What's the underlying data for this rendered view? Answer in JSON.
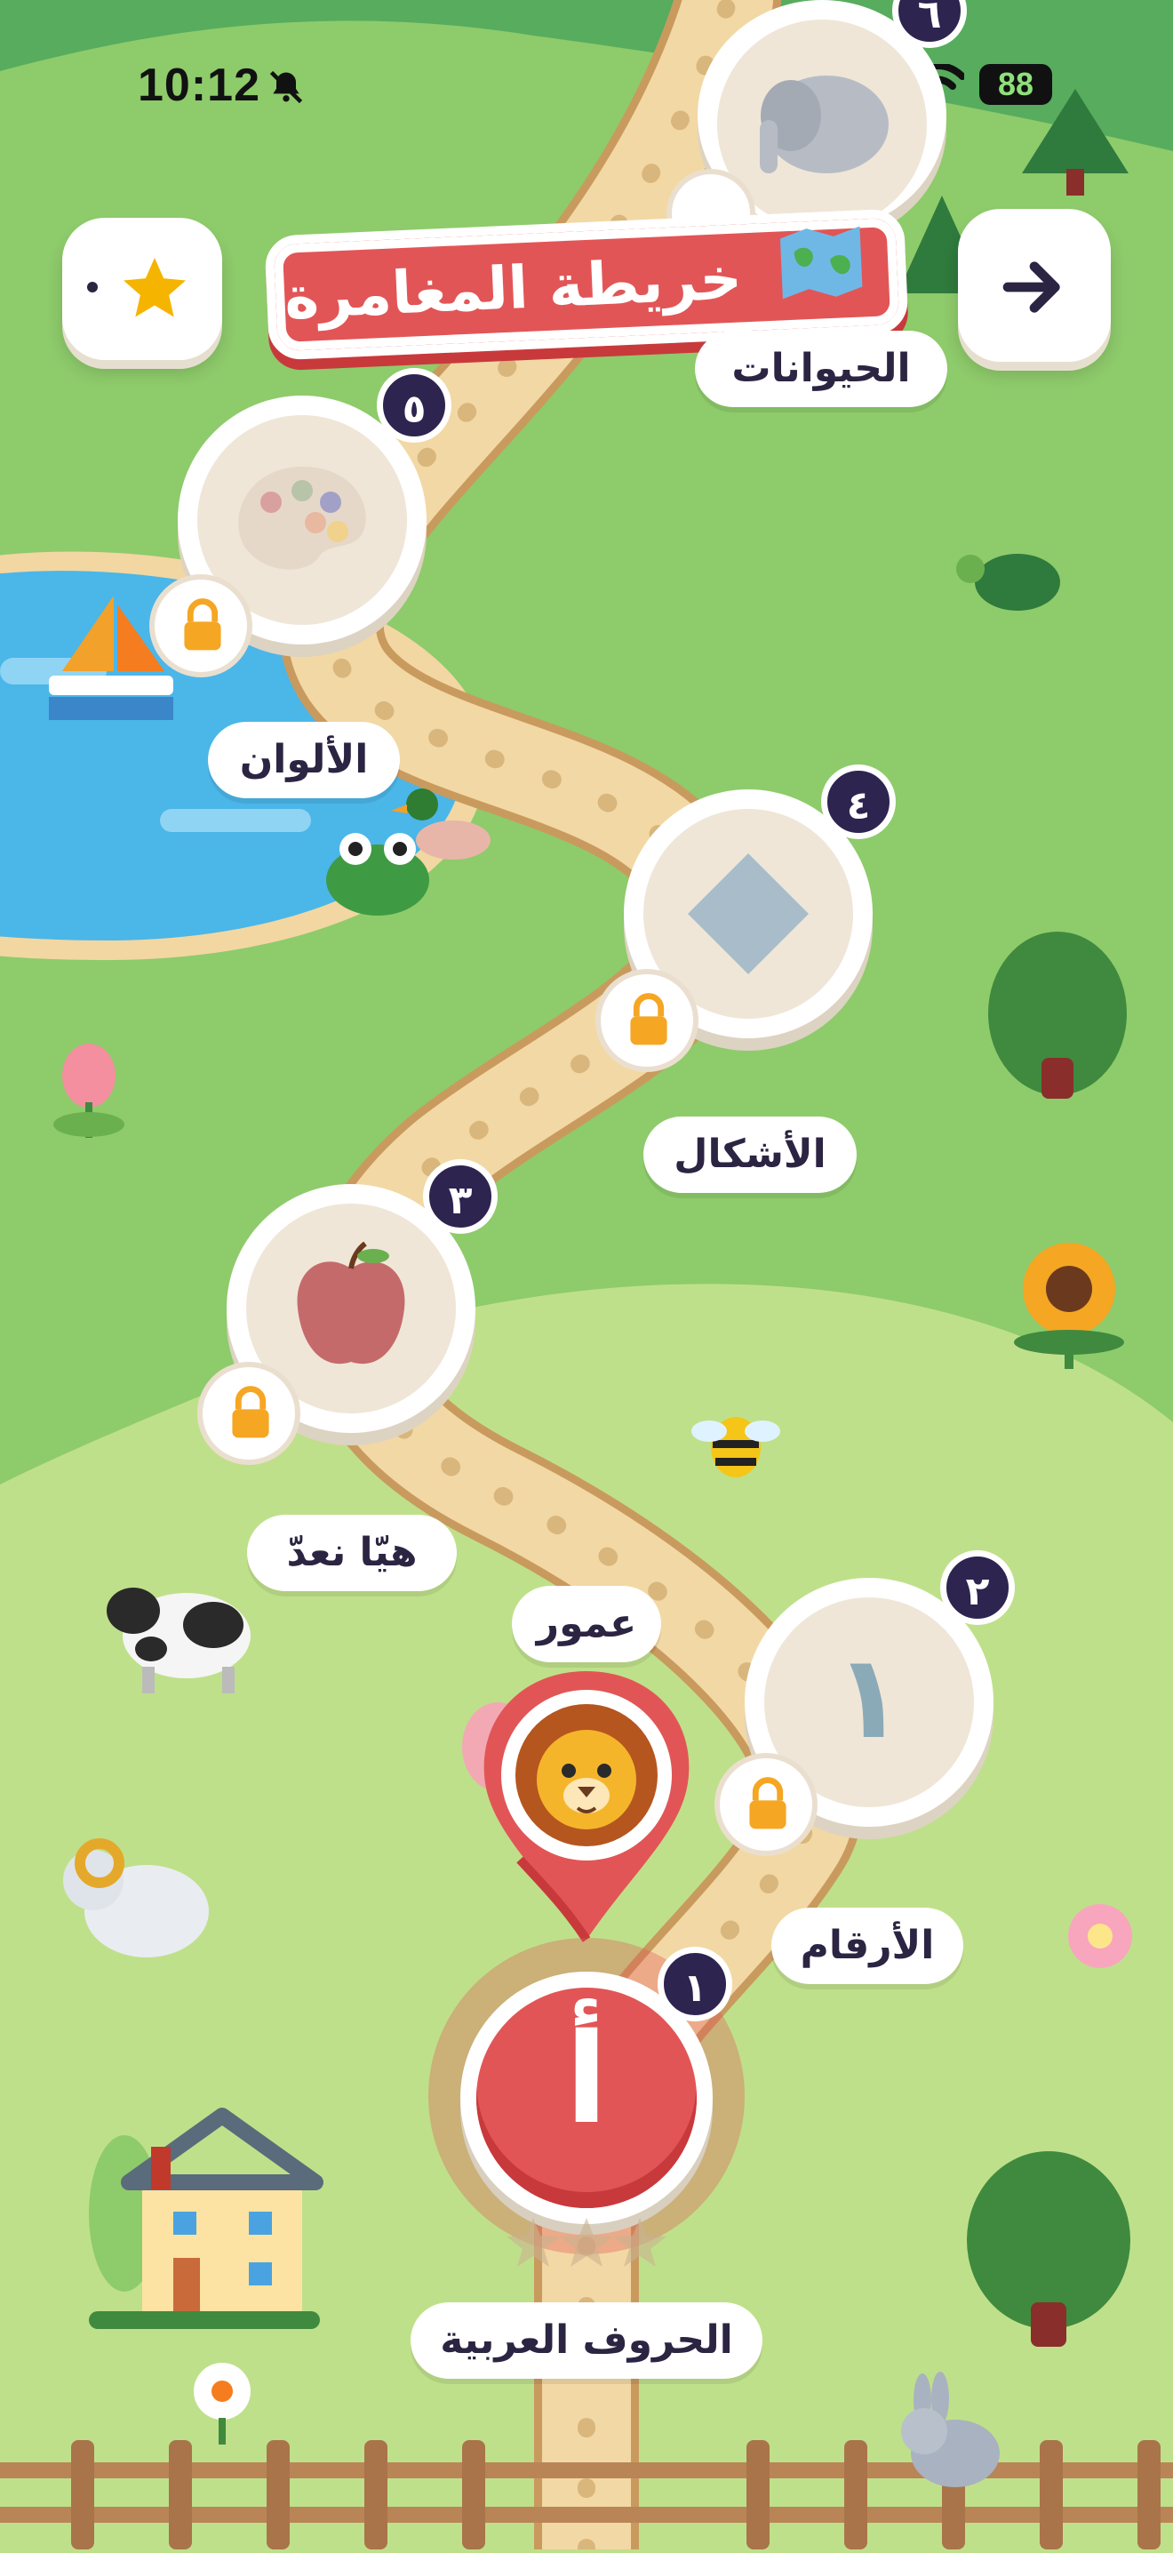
{
  "status_bar": {
    "time": "10:12",
    "battery": "88"
  },
  "header": {
    "title": "خريطة المغامرة",
    "back_icon": "arrow-right-icon",
    "stars_icon": "star-icon"
  },
  "levels": [
    {
      "number": "١",
      "label": "الحروف العربية",
      "glyph": "أ",
      "locked": false,
      "current": true
    },
    {
      "number": "٢",
      "label": "الأرقام",
      "glyph": "١",
      "locked": true
    },
    {
      "number": "٣",
      "label": "هيّا نعدّ",
      "icon": "apple-icon",
      "locked": true
    },
    {
      "number": "٤",
      "label": "الأشكال",
      "icon": "diamond-icon",
      "locked": true
    },
    {
      "number": "٥",
      "label": "الألوان",
      "icon": "palette-icon",
      "locked": true
    },
    {
      "number": "٦",
      "label": "الحيوانات",
      "icon": "elephant-icon",
      "locked": true
    }
  ],
  "player": {
    "name": "عمور",
    "avatar": "lion-icon"
  },
  "colors": {
    "accent": "#e25556",
    "badge": "#2d2450",
    "lock": "#f5a623",
    "path": "#f2d8a4",
    "water": "#4bb6e8"
  }
}
